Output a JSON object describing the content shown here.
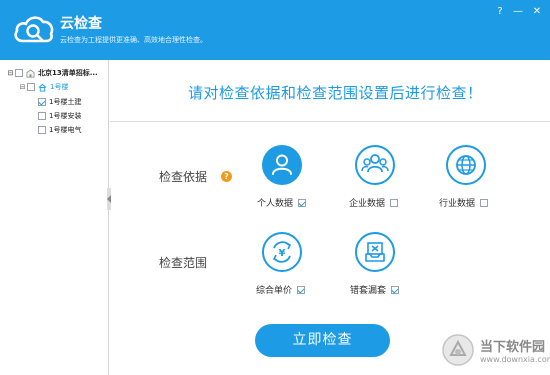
{
  "app": {
    "title": "云检查",
    "subtitle": "云检查为工程提供更准确、高效地合理性检查。",
    "logo_icon": "cloud-search-icon",
    "help_symbol": "?",
    "minimize_symbol": "—",
    "close_symbol": "✕",
    "accent_color": "#1d9be5"
  },
  "tree": {
    "root": {
      "label": "北京13清单招标...",
      "checked": false,
      "expanded": true
    },
    "building": {
      "label": "1号楼",
      "checked": false,
      "expanded": true
    },
    "children": [
      {
        "label": "1号楼土建",
        "checked": true
      },
      {
        "label": "1号楼安装",
        "checked": false
      },
      {
        "label": "1号楼电气",
        "checked": false
      }
    ]
  },
  "main": {
    "headline": "请对检查依据和检查范围设置后进行检查！",
    "basis": {
      "label": "检查依据",
      "help_symbol": "?",
      "options": [
        {
          "label": "个人数据",
          "checked": true,
          "icon": "person-icon"
        },
        {
          "label": "企业数据",
          "checked": false,
          "icon": "group-icon"
        },
        {
          "label": "行业数据",
          "checked": false,
          "icon": "globe-icon"
        }
      ]
    },
    "range": {
      "label": "检查范围",
      "options": [
        {
          "label": "综合单价",
          "checked": true,
          "icon": "yen-refresh-icon"
        },
        {
          "label": "错套漏套",
          "checked": true,
          "icon": "tray-x-icon"
        }
      ]
    },
    "start_button": "立即检查"
  },
  "watermark": {
    "title": "当下软件园",
    "url": "www.downxia.com"
  }
}
